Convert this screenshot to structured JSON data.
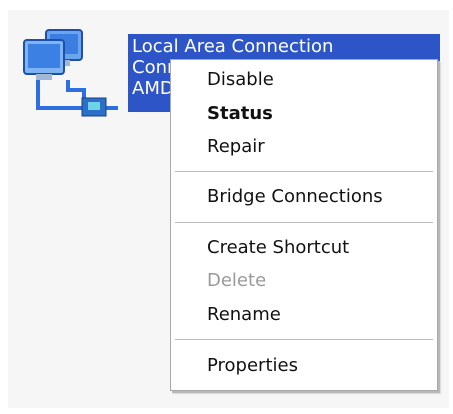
{
  "connection": {
    "name": "Local Area Connection",
    "status_truncated": "Conn",
    "device_truncated": "AMD",
    "icon": "network-connection-icon"
  },
  "context_menu": {
    "items": [
      {
        "label": "Disable"
      },
      {
        "label": "Status"
      },
      {
        "label": "Repair"
      },
      {
        "label": "Bridge Connections"
      },
      {
        "label": "Create Shortcut"
      },
      {
        "label": "Delete"
      },
      {
        "label": "Rename"
      },
      {
        "label": "Properties"
      }
    ]
  },
  "colors": {
    "selection": "#2d55c8",
    "disabled_text": "#9a9a9a"
  }
}
